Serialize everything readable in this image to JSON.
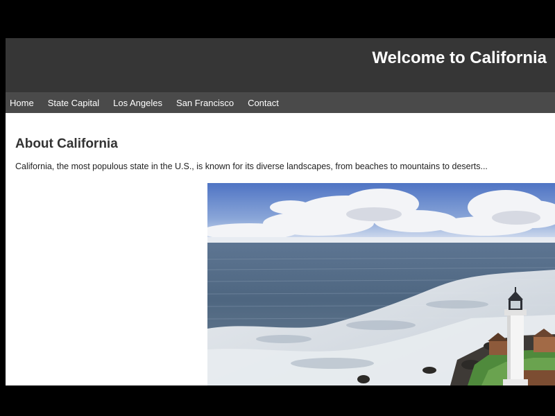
{
  "header": {
    "title": "Welcome to California"
  },
  "nav": {
    "items": [
      {
        "label": "Home"
      },
      {
        "label": "State Capital"
      },
      {
        "label": "Los Angeles"
      },
      {
        "label": "San Francisco"
      },
      {
        "label": "Contact"
      }
    ]
  },
  "main": {
    "heading": "About California",
    "paragraph": "California, the most populous state in the U.S., is known for its diverse landscapes, from beaches to mountains to deserts..."
  },
  "image": {
    "subject": "coastal-lighthouse-photo",
    "icon": "lighthouse-icon"
  },
  "colors": {
    "header_bg": "#363636",
    "nav_bg": "#4a4a4a",
    "page_bg": "#ffffff",
    "frame_bg": "#000000"
  }
}
